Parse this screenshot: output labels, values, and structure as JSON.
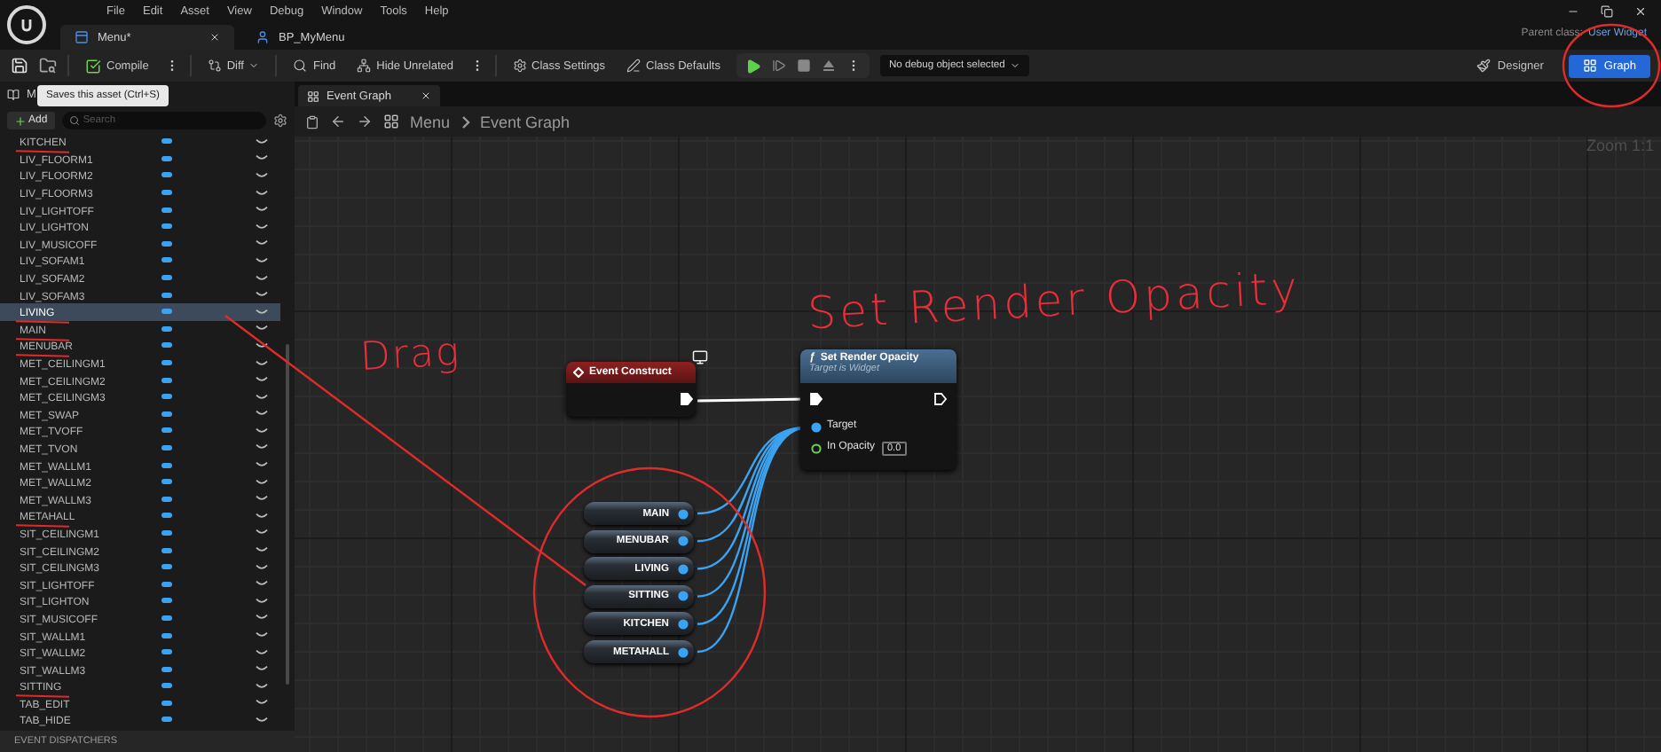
{
  "menu_bar": [
    "File",
    "Edit",
    "Asset",
    "View",
    "Debug",
    "Window",
    "Tools",
    "Help"
  ],
  "document_tabs": [
    {
      "label": "Menu*",
      "selected": true
    },
    {
      "label": "BP_MyMenu",
      "selected": false
    }
  ],
  "parent_class": {
    "label": "Parent class:",
    "value": "User Widget"
  },
  "toolbar": {
    "compile": "Compile",
    "diff": "Diff",
    "find": "Find",
    "hide_unrelated": "Hide Unrelated",
    "class_settings": "Class Settings",
    "class_defaults": "Class Defaults",
    "debug_object": "No debug object selected"
  },
  "mode_buttons": [
    {
      "label": "Designer",
      "selected": false
    },
    {
      "label": "Graph",
      "selected": true
    }
  ],
  "tooltip": "Saves this asset (Ctrl+S)",
  "my_blueprint": {
    "title": "M",
    "add": "Add",
    "search_placeholder": "Search",
    "next_section": "EVENT DISPATCHERS",
    "variables": [
      {
        "name": "KITCHEN",
        "selected": false,
        "underlined": true
      },
      {
        "name": "LIV_FLOORM1",
        "selected": false,
        "underlined": false
      },
      {
        "name": "LIV_FLOORM2",
        "selected": false,
        "underlined": false
      },
      {
        "name": "LIV_FLOORM3",
        "selected": false,
        "underlined": false
      },
      {
        "name": "LIV_LIGHTOFF",
        "selected": false,
        "underlined": false
      },
      {
        "name": "LIV_LIGHTON",
        "selected": false,
        "underlined": false
      },
      {
        "name": "LIV_MUSICOFF",
        "selected": false,
        "underlined": false
      },
      {
        "name": "LIV_SOFAM1",
        "selected": false,
        "underlined": false
      },
      {
        "name": "LIV_SOFAM2",
        "selected": false,
        "underlined": false
      },
      {
        "name": "LIV_SOFAM3",
        "selected": false,
        "underlined": false
      },
      {
        "name": "LIVING",
        "selected": true,
        "underlined": true
      },
      {
        "name": "MAIN",
        "selected": false,
        "underlined": true
      },
      {
        "name": "MENUBAR",
        "selected": false,
        "underlined": true
      },
      {
        "name": "MET_CEILINGM1",
        "selected": false,
        "underlined": false
      },
      {
        "name": "MET_CEILINGM2",
        "selected": false,
        "underlined": false
      },
      {
        "name": "MET_CEILINGM3",
        "selected": false,
        "underlined": false
      },
      {
        "name": "MET_SWAP",
        "selected": false,
        "underlined": false
      },
      {
        "name": "MET_TVOFF",
        "selected": false,
        "underlined": false
      },
      {
        "name": "MET_TVON",
        "selected": false,
        "underlined": false
      },
      {
        "name": "MET_WALLM1",
        "selected": false,
        "underlined": false
      },
      {
        "name": "MET_WALLM2",
        "selected": false,
        "underlined": false
      },
      {
        "name": "MET_WALLM3",
        "selected": false,
        "underlined": false
      },
      {
        "name": "METAHALL",
        "selected": false,
        "underlined": true
      },
      {
        "name": "SIT_CEILINGM1",
        "selected": false,
        "underlined": false
      },
      {
        "name": "SIT_CEILINGM2",
        "selected": false,
        "underlined": false
      },
      {
        "name": "SIT_CEILINGM3",
        "selected": false,
        "underlined": false
      },
      {
        "name": "SIT_LIGHTOFF",
        "selected": false,
        "underlined": false
      },
      {
        "name": "SIT_LIGHTON",
        "selected": false,
        "underlined": false
      },
      {
        "name": "SIT_MUSICOFF",
        "selected": false,
        "underlined": false
      },
      {
        "name": "SIT_WALLM1",
        "selected": false,
        "underlined": false
      },
      {
        "name": "SIT_WALLM2",
        "selected": false,
        "underlined": false
      },
      {
        "name": "SIT_WALLM3",
        "selected": false,
        "underlined": false
      },
      {
        "name": "SITTING",
        "selected": false,
        "underlined": true
      },
      {
        "name": "TAB_EDIT",
        "selected": false,
        "underlined": false
      },
      {
        "name": "TAB_HIDE",
        "selected": false,
        "underlined": false
      }
    ]
  },
  "graph_tab": "Event Graph",
  "breadcrumb": [
    "Menu",
    "Event Graph"
  ],
  "zoom": "Zoom 1:1",
  "event_node": {
    "title": "Event Construct"
  },
  "function_node": {
    "icon": "ƒ",
    "title": "Set Render Opacity",
    "subtitle": "Target is Widget",
    "target_pin": "Target",
    "opacity_pin": "In Opacity",
    "opacity_value": "0.0"
  },
  "variable_nodes": [
    "MAIN",
    "MENUBAR",
    "LIVING",
    "SITTING",
    "KITCHEN",
    "METAHALL"
  ],
  "annotations": [
    {
      "kind": "title",
      "text": "Set Render Opacity"
    },
    {
      "kind": "note",
      "text": "Drag"
    }
  ]
}
